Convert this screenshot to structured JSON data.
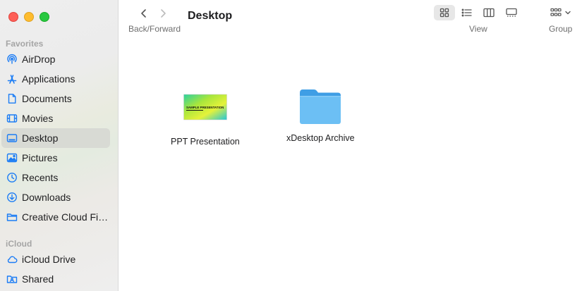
{
  "window": {
    "title": "Desktop"
  },
  "sidebar": {
    "favorites_label": "Favorites",
    "favorites": [
      {
        "label": "AirDrop",
        "icon": "airdrop-icon"
      },
      {
        "label": "Applications",
        "icon": "applications-icon"
      },
      {
        "label": "Documents",
        "icon": "document-icon"
      },
      {
        "label": "Movies",
        "icon": "movies-icon"
      },
      {
        "label": "Desktop",
        "icon": "desktop-icon",
        "selected": true
      },
      {
        "label": "Pictures",
        "icon": "pictures-icon"
      },
      {
        "label": "Recents",
        "icon": "clock-icon"
      },
      {
        "label": "Downloads",
        "icon": "download-icon"
      },
      {
        "label": "Creative Cloud Files",
        "icon": "folder-icon"
      }
    ],
    "icloud_label": "iCloud",
    "icloud": [
      {
        "label": "iCloud Drive",
        "icon": "cloud-icon"
      },
      {
        "label": "Shared",
        "icon": "shared-folder-icon"
      }
    ]
  },
  "toolbar": {
    "back_forward_label": "Back/Forward",
    "view_label": "View",
    "group_label": "Group",
    "view_modes": [
      "icon-view",
      "list-view",
      "column-view",
      "gallery-view"
    ],
    "active_view": "icon-view"
  },
  "files": [
    {
      "name": "PPT Presentation",
      "thumbnail_text": "SAMPLE PRESENTATION"
    },
    {
      "name": "xDesktop Archive",
      "icon": "folder-icon"
    }
  ],
  "colors": {
    "accent": "#1b7cf5",
    "folder": "#6cbff4",
    "selection": "#d8dad4"
  }
}
